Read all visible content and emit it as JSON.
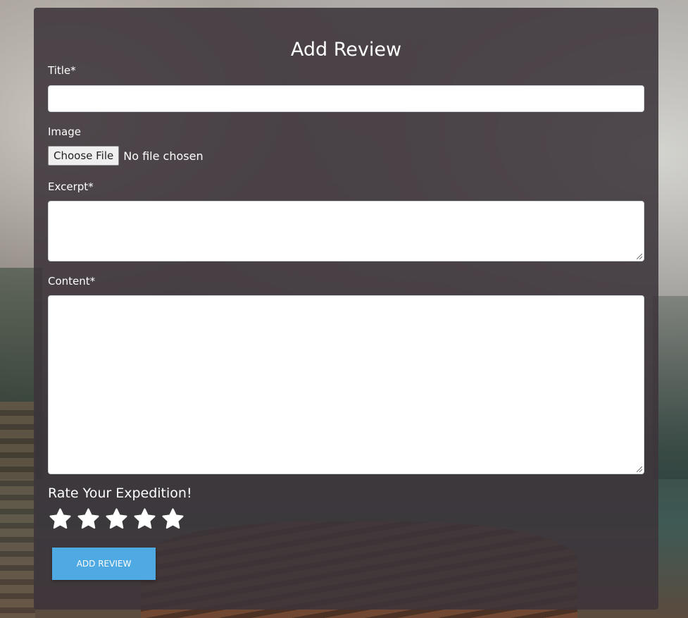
{
  "form": {
    "title": "Add Review",
    "title_label": "Title*",
    "title_value": "",
    "image_label": "Image",
    "file_button_label": "Choose File",
    "file_status": "No file chosen",
    "excerpt_label": "Excerpt*",
    "excerpt_value": "",
    "content_label": "Content*",
    "content_value": "",
    "rating_label": "Rate Your Expedition!",
    "rating_value": 0,
    "rating_max": 5,
    "submit_label": "ADD REVIEW"
  },
  "icons": {
    "star": "star-icon"
  },
  "colors": {
    "panel": "#3c343a",
    "accent": "#4fa9e3",
    "text": "#ffffff",
    "star": "#ffffff"
  }
}
